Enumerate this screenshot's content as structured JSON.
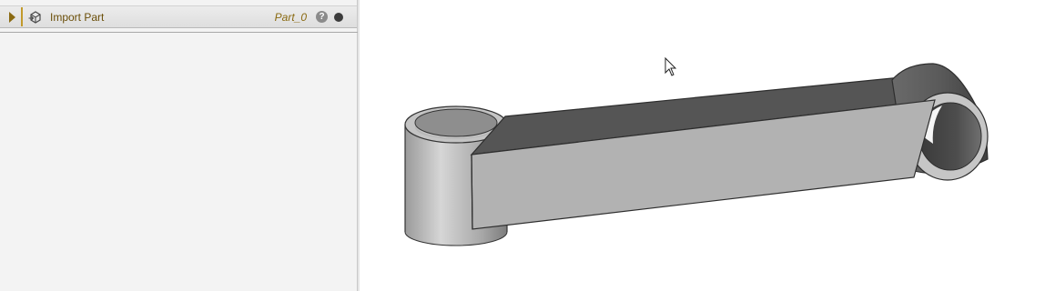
{
  "tree": {
    "feature": {
      "label": "Import Part",
      "output": "Part_0",
      "help_symbol": "?",
      "icon": "import-part-icon"
    }
  },
  "viewport": {
    "model": "connecting-link-part",
    "cursor": "arrow-cursor",
    "colors": {
      "top_face": "#555555",
      "side_face": "#b2b2b2",
      "background": "#ffffff"
    }
  }
}
